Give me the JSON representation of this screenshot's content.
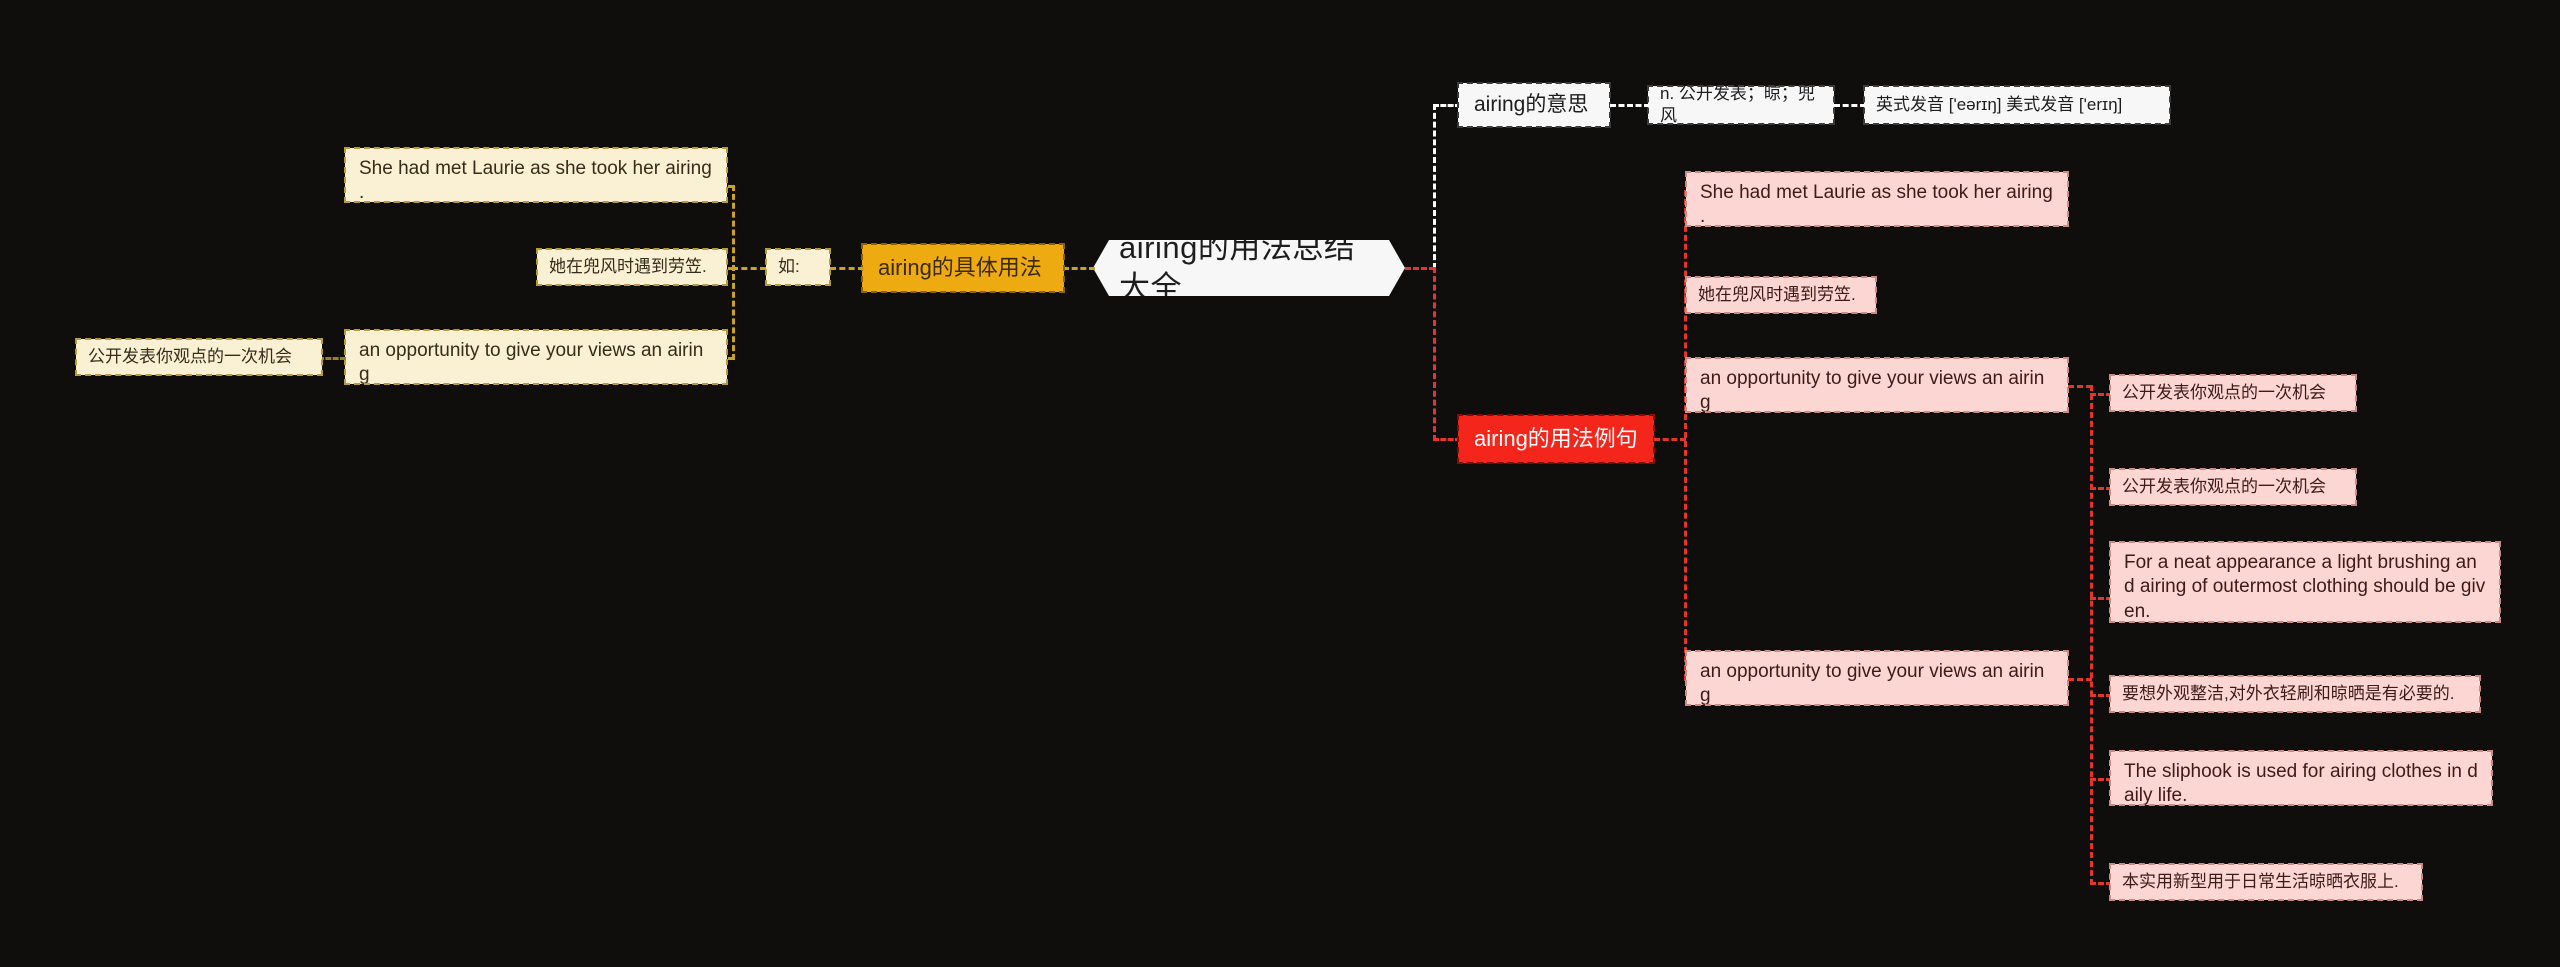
{
  "theme": {
    "background": "#100d0d",
    "root_bg": "#f7f7f7",
    "gold_accent": "#eeaa11",
    "red_accent": "#f4251b",
    "pink_bg": "#fbd6d2",
    "cream_bg": "#faf0d4",
    "white_connector": "#ffffff",
    "red_connector": "#e0372c",
    "gold_connector": "#c9a227"
  },
  "root": {
    "title": "airing的用法总结大全"
  },
  "meaning_branch": {
    "label": "airing的意思",
    "definition": "n. 公开发表；晾；兜风",
    "pronunciation": "英式发音 ['eərɪŋ] 美式发音 ['erɪŋ]"
  },
  "usage_branch": {
    "label": "airing的具体用法",
    "connector_label": "如:",
    "examples": [
      {
        "en": "She had met Laurie as she took her airing ."
      },
      {
        "zh": "她在兜风时遇到劳笠."
      },
      {
        "en": "an opportunity to give your views an airing",
        "zh": "公开发表你观点的一次机会"
      }
    ],
    "english_1": "She had met Laurie as she took her airing .",
    "chinese_1": "她在兜风时遇到劳笠.",
    "english_2": "an opportunity to give your views an airing",
    "chinese_2": "公开发表你观点的一次机会"
  },
  "sentences_branch": {
    "label": "airing的用法例句",
    "items": [
      {
        "en": "She had met Laurie as she took her airing ."
      },
      {
        "zh": "她在兜风时遇到劳笠."
      },
      {
        "en": "an opportunity to give your views an airing",
        "zh_a": "公开发表你观点的一次机会",
        "zh_b": "公开发表你观点的一次机会",
        "en_long": "For a neat appearance a light brushing and airing of outermost clothing should be given."
      },
      {
        "en": "an opportunity to give your views an airing",
        "zh_a": "要想外观整洁,对外衣轻刷和晾晒是有必要的.",
        "en_long": "The sliphook is used for airing clothes in daily life.",
        "zh_b": "本实用新型用于日常生活晾晒衣服上."
      }
    ],
    "sentence_1_en": "She had met Laurie as she took her airing .",
    "sentence_1_zh": "她在兜风时遇到劳笠.",
    "sentence_2_en": "an opportunity to give your views an airing",
    "sentence_2_zh_a": "公开发表你观点的一次机会",
    "sentence_2_zh_b": "公开发表你观点的一次机会",
    "sentence_3_en": "For a neat appearance a light brushing and airing of outermost clothing should be given.",
    "sentence_4_en": "an opportunity to give your views an airing",
    "sentence_4_zh": "要想外观整洁,对外衣轻刷和晾晒是有必要的.",
    "sentence_5_en": "The sliphook is used for airing clothes in daily life.",
    "sentence_5_zh": "本实用新型用于日常生活晾晒衣服上."
  }
}
